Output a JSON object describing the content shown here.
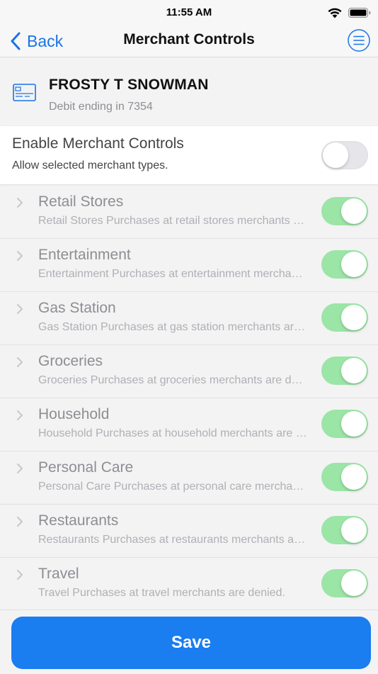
{
  "status_bar": {
    "time": "11:55 AM"
  },
  "nav": {
    "back_label": "Back",
    "title": "Merchant Controls"
  },
  "card": {
    "holder": "FROSTY T SNOWMAN",
    "subtitle": "Debit ending in 7354"
  },
  "enable": {
    "title": "Enable Merchant Controls",
    "subtitle": "Allow selected merchant types.",
    "enabled": false
  },
  "categories": [
    {
      "name": "Retail Stores",
      "description": "Retail Stores Purchases at retail stores merchants are denied.",
      "enabled": true
    },
    {
      "name": "Entertainment",
      "description": "Entertainment Purchases at entertainment merchants are denied.",
      "enabled": true
    },
    {
      "name": "Gas Station",
      "description": "Gas Station Purchases at gas station merchants are denied.",
      "enabled": true
    },
    {
      "name": "Groceries",
      "description": "Groceries Purchases at groceries merchants are denied.",
      "enabled": true
    },
    {
      "name": "Household",
      "description": "Household Purchases at household merchants are denied.",
      "enabled": true
    },
    {
      "name": "Personal Care",
      "description": "Personal Care Purchases at personal care merchants are denied.",
      "enabled": true
    },
    {
      "name": "Restaurants",
      "description": "Restaurants Purchases at restaurants merchants are denied.",
      "enabled": true
    },
    {
      "name": "Travel",
      "description": "Travel Purchases at travel merchants are denied.",
      "enabled": true
    }
  ],
  "footer": {
    "save_label": "Save"
  },
  "colors": {
    "accent": "#1a7df0",
    "toggle_on": "#9be5a6",
    "toggle_off": "#e6e6ea"
  },
  "icons": {
    "back": "chevron-left-icon",
    "menu": "menu-circle-icon",
    "card": "credit-card-icon",
    "row": "chevron-right-icon",
    "wifi": "wifi-icon",
    "battery": "battery-icon"
  }
}
